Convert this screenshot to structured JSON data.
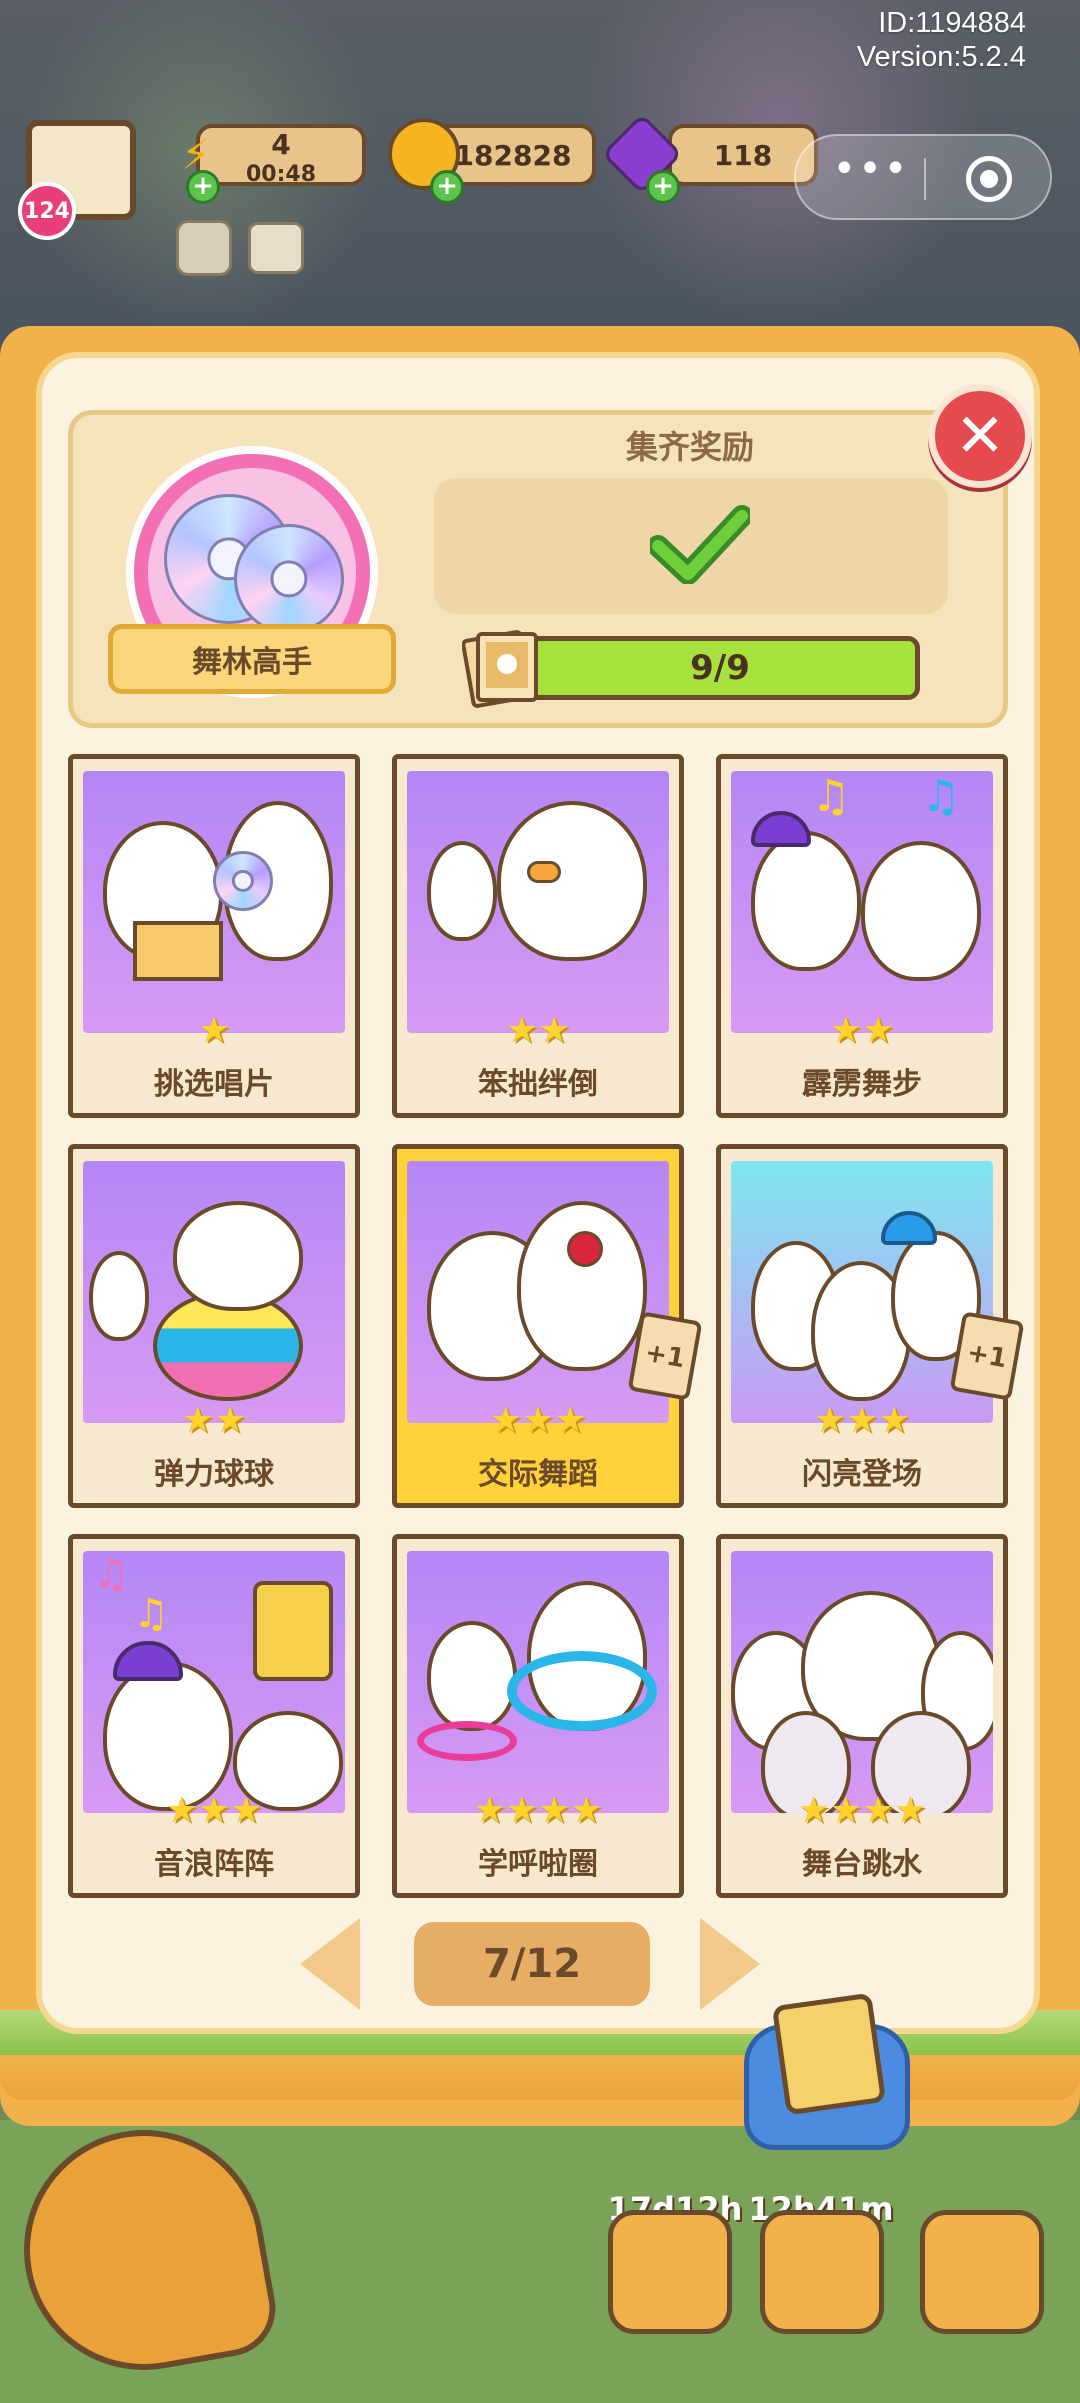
{
  "overlay": {
    "id": "ID:1194884",
    "version": "Version:5.2.4"
  },
  "hud": {
    "level": "124",
    "energy": "4",
    "energy_timer": "00:48",
    "coins": "182828",
    "gems": "118"
  },
  "album": {
    "name": "舞林高手",
    "reward_title": "集齐奖励",
    "progress": "9/9"
  },
  "cards": [
    {
      "label": "挑选唱片",
      "stars": "★"
    },
    {
      "label": "笨拙绊倒",
      "stars": "★★"
    },
    {
      "label": "霹雳舞步",
      "stars": "★★"
    },
    {
      "label": "弹力球球",
      "stars": "★★"
    },
    {
      "label": "交际舞蹈",
      "stars": "★★★",
      "badge": "+1"
    },
    {
      "label": "闪亮登场",
      "stars": "★★★",
      "badge": "+1"
    },
    {
      "label": "音浪阵阵",
      "stars": "★★★"
    },
    {
      "label": "学呼啦圈",
      "stars": "★★★★"
    },
    {
      "label": "舞台跳水",
      "stars": "★★★★"
    }
  ],
  "pagination": {
    "page": "7/12"
  },
  "bottom": {
    "timer1": "17d12h",
    "timer2": "12h41m"
  },
  "colors": {
    "panel_bg": "#fbf3df",
    "book_orange": "#f2b14b",
    "card_purple": "#b487f5",
    "progress_green": "#a7e23c",
    "close_red": "#e54a4f"
  }
}
